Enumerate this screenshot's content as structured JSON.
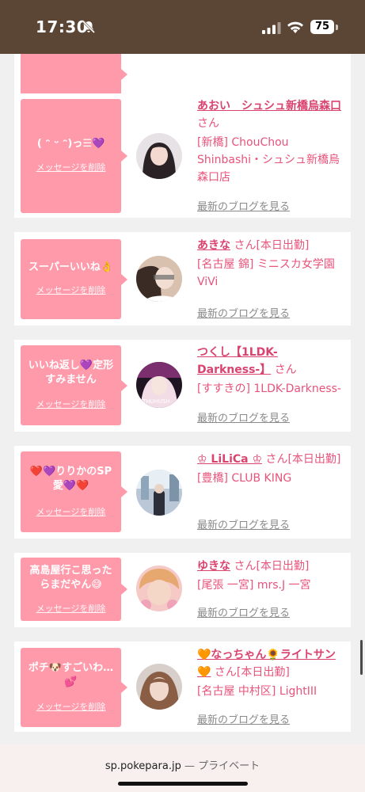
{
  "status_bar": {
    "time": "17:30",
    "battery": "75"
  },
  "common": {
    "delete_label": "メッセージを削除",
    "blog_label": "最新のブログを見る",
    "san": "さん"
  },
  "cards": [
    {
      "message": "",
      "name": "",
      "suffix": "",
      "shop": ""
    },
    {
      "message": "( ᵔ ᵕ ᵔ)っ☰💜",
      "name": "あおい　シュシュ新橋烏森口",
      "suffix": "",
      "shop": "[新橋] ChouChou Shinbashi・シュシュ新橋烏森口店"
    },
    {
      "message": "スーパーいいね👌",
      "name": "あきな",
      "suffix": "[本日出勤]",
      "shop": "[名古屋 錦] ミニスカ女学園ViVi"
    },
    {
      "message": "いいね返し💜定形\nすみません",
      "name": "つくし【1LDK-Darkness-】",
      "suffix": "",
      "shop": "[すすきの] 1LDK-Darkness-"
    },
    {
      "message": "❤️💜りりかのSP\n愛💜❤️",
      "name": "♔ LiLiCa ♔",
      "suffix": "[本日出勤]",
      "shop": "[豊橋] CLUB KING"
    },
    {
      "message": "高島屋行こ思った\nらまだやん😅",
      "name": "ゆきな",
      "suffix": "[本日出勤]",
      "shop": "[尾張 一宮] mrs.J 一宮"
    },
    {
      "message": "ポチ🐶すごいわ…\n💕",
      "name": "🧡なっちゃん🌻ライトサン🧡",
      "suffix": "[本日出勤]",
      "shop": "[名古屋 中村区] LightIII"
    }
  ],
  "bottom_bar": {
    "domain": "sp.pokepara.jp",
    "separator": " — ",
    "mode": "プライベート"
  },
  "colors": {
    "status_bar": "#5b4636",
    "message_box": "#ff9aab",
    "name_text": "#d9436e",
    "link_text": "#8a8a8a"
  }
}
